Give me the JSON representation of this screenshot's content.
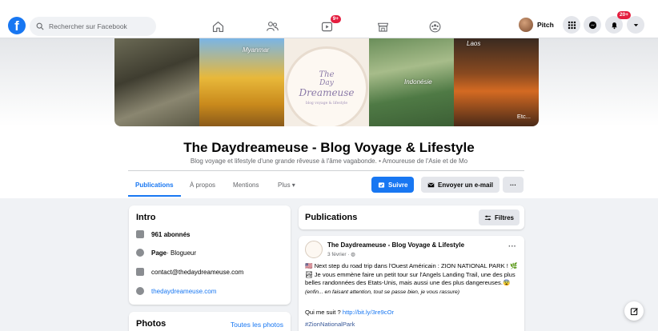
{
  "nav": {
    "logo": "f",
    "search_placeholder": "Rechercher sur Facebook",
    "watch_badge": "9+",
    "profile_name": "Pitch",
    "notifications_badge": "20+",
    "icons": [
      "home-icon",
      "friends-icon",
      "watch-icon",
      "marketplace-icon",
      "groups-icon",
      "menu-grid-icon",
      "messenger-icon",
      "bell-icon",
      "account-caret-icon"
    ]
  },
  "cover": {
    "logo_line1": "The",
    "logo_line2": "Day",
    "logo_line3": "Dreameuse",
    "logo_tagline": "blog voyage & lifestyle",
    "label_myanmar": "Myanmar",
    "label_indonesie": "Indonésie",
    "label_laos": "Laos",
    "label_etc": "Etc..."
  },
  "page": {
    "title": "The Daydreameuse - Blog Voyage & Lifestyle",
    "description": "Blog voyage et lifestyle d'une grande rêveuse à l'âme vagabonde. • Amoureuse de l'Asie et de Mo"
  },
  "tabs": [
    "Publications",
    "À propos",
    "Mentions",
    "Plus ▾"
  ],
  "actions": {
    "follow": "Suivre",
    "email": "Envoyer un e-mail",
    "more": "···"
  },
  "intro": {
    "title": "Intro",
    "followers": "961 abonnés",
    "page_label": "Page",
    "page_category": " · Blogueur",
    "email": "contact@thedaydreameuse.com",
    "website": "thedaydreameuse.com"
  },
  "photos": {
    "title": "Photos",
    "see_all": "Toutes les photos"
  },
  "publications": {
    "title": "Publications",
    "filters": "Filtres"
  },
  "post": {
    "author": "The Daydreameuse - Blog Voyage & Lifestyle",
    "date": "3 février · ◍",
    "text": "🇺🇸 Next step du road trip dans l'Ouest Américain : ZION NATIONAL PARK ! 🌿🏞 Je vous emmène faire un petit tour sur l'Angels Landing Trail, une des plus belles randonnées des Etats-Unis, mais aussi une des plus dangereuses.😨 ",
    "text_italic": "(enfin... en faisant attention, tout se passe bien, je vous rassure)",
    "call": "Qui me suit ? ",
    "link": "http://bit.ly/3re9cOr",
    "hashtag": "#ZionNationalPark"
  },
  "colors": {
    "brand": "#1877f2",
    "badge": "#e41e3f",
    "background": "#f0f2f5"
  }
}
